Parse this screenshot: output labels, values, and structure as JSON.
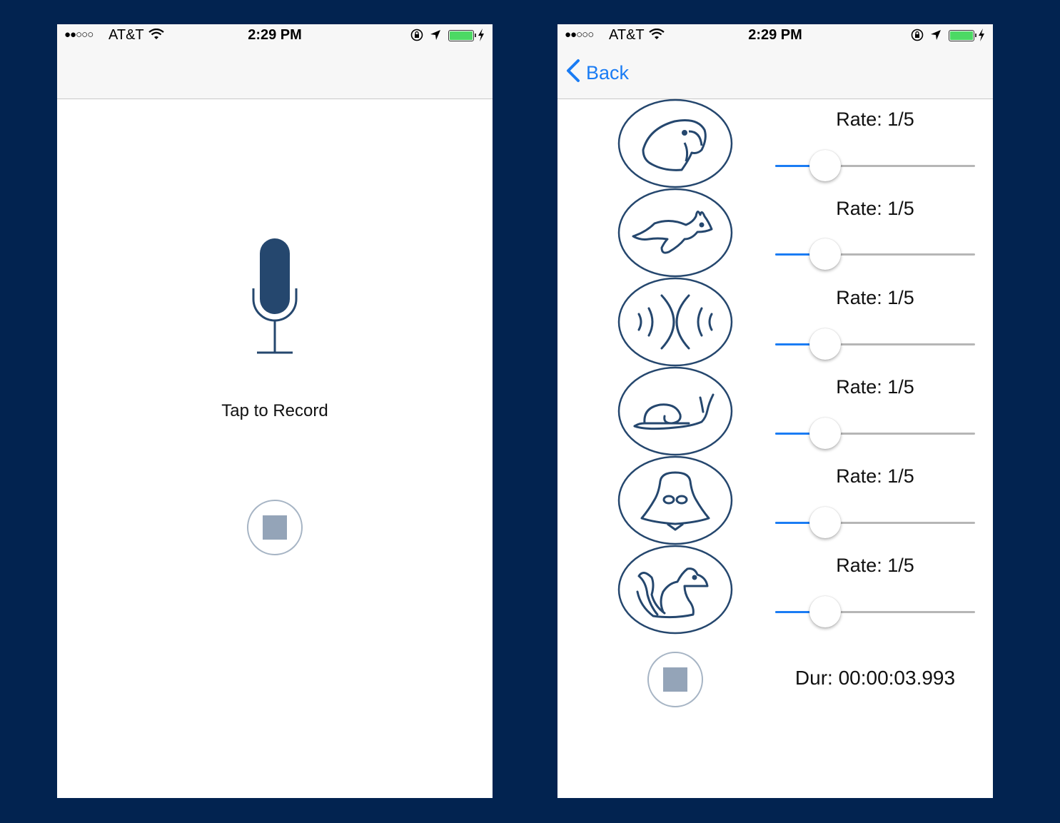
{
  "status_bar": {
    "signal": "●●○○○",
    "carrier": "AT&T",
    "time": "2:29 PM"
  },
  "record_screen": {
    "prompt": "Tap to Record"
  },
  "playback_screen": {
    "back_label": "Back",
    "effects": [
      {
        "icon": "parrot-icon",
        "rate": "Rate: 1/5",
        "slider_fraction": 0.25
      },
      {
        "icon": "rabbit-icon",
        "rate": "Rate: 1/5",
        "slider_fraction": 0.25
      },
      {
        "icon": "echo-icon",
        "rate": "Rate: 1/5",
        "slider_fraction": 0.25
      },
      {
        "icon": "snail-icon",
        "rate": "Rate: 1/5",
        "slider_fraction": 0.25
      },
      {
        "icon": "darth-vader-icon",
        "rate": "Rate: 1/5",
        "slider_fraction": 0.25
      },
      {
        "icon": "squirrel-icon",
        "rate": "Rate: 1/5",
        "slider_fraction": 0.25
      }
    ],
    "duration": "Dur: 00:00:03.993"
  },
  "colors": {
    "background": "#022350",
    "icon_stroke": "#25476e",
    "tint": "#1a7cf4",
    "stop_fill": "#94a4b8",
    "battery": "#4cd964"
  }
}
